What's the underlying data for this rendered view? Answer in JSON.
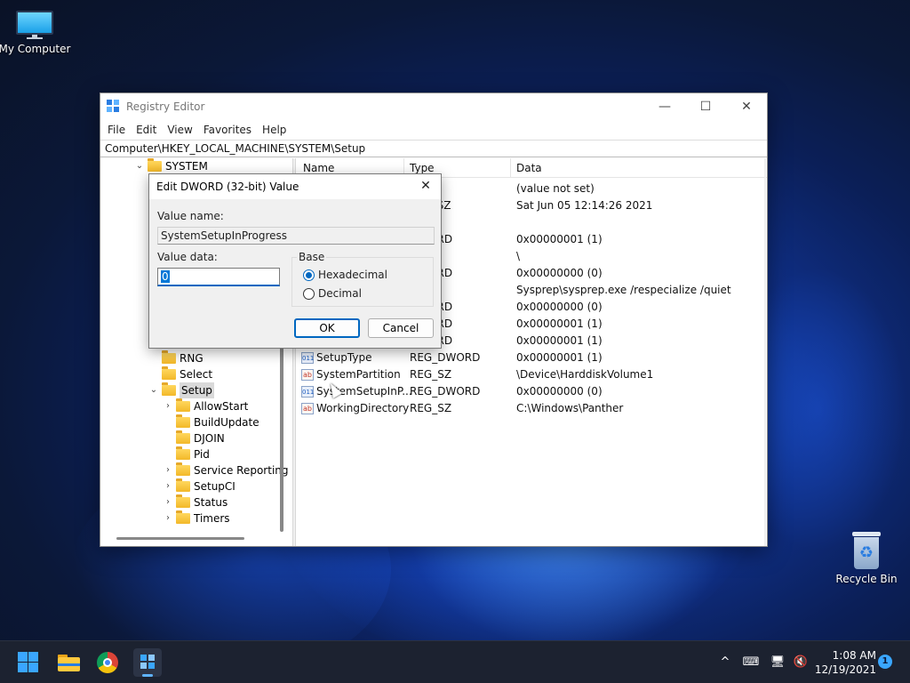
{
  "desktop": {
    "icons": [
      {
        "label": "My Computer",
        "icon": "computer-icon"
      },
      {
        "label": "Recycle Bin",
        "icon": "recycle-bin-icon"
      }
    ]
  },
  "window": {
    "title": "Registry Editor",
    "controls": {
      "minimize": "—",
      "maximize": "☐",
      "close": "✕"
    },
    "menu": [
      "File",
      "Edit",
      "View",
      "Favorites",
      "Help"
    ],
    "address": "Computer\\HKEY_LOCAL_MACHINE\\SYSTEM\\Setup"
  },
  "tree": {
    "root": "SYSTEM",
    "items": [
      {
        "label": "RNG",
        "expandable": false
      },
      {
        "label": "Select",
        "expandable": false
      },
      {
        "label": "Setup",
        "expandable": true,
        "expanded": true,
        "selected": true
      },
      {
        "label": "AllowStart",
        "expandable": true
      },
      {
        "label": "BuildUpdate",
        "expandable": false
      },
      {
        "label": "DJOIN",
        "expandable": false
      },
      {
        "label": "Pid",
        "expandable": false
      },
      {
        "label": "Service Reporting",
        "expandable": true
      },
      {
        "label": "SetupCI",
        "expandable": true
      },
      {
        "label": "Status",
        "expandable": true
      },
      {
        "label": "Timers",
        "expandable": true
      }
    ]
  },
  "list": {
    "columns": [
      "Name",
      "Type",
      "Data"
    ],
    "rows": [
      {
        "name": "",
        "type": "",
        "data": "(value not set)",
        "icon": ""
      },
      {
        "name": "",
        "type": "ULTI_SZ",
        "data": "Sat Jun 05 12:14:26 2021",
        "icon": ""
      },
      {
        "name": "",
        "type": "",
        "data": "",
        "icon": ""
      },
      {
        "name": "",
        "type": "DWORD",
        "data": "0x00000001 (1)",
        "icon": ""
      },
      {
        "name": "",
        "type": "",
        "data": "\\",
        "icon": ""
      },
      {
        "name": "",
        "type": "DWORD",
        "data": "0x00000000 (0)",
        "icon": ""
      },
      {
        "name": "",
        "type": "",
        "data": "Sysprep\\sysprep.exe /respecialize /quiet",
        "icon": ""
      },
      {
        "name": "",
        "type": "DWORD",
        "data": "0x00000000 (0)",
        "icon": ""
      },
      {
        "name": "",
        "type": "DWORD",
        "data": "0x00000001 (1)",
        "icon": ""
      },
      {
        "name": "",
        "type": "DWORD",
        "data": "0x00000001 (1)",
        "icon": ""
      },
      {
        "name": "SetupType",
        "type": "REG_DWORD",
        "data": "0x00000001 (1)",
        "icon": "dword-value-icon"
      },
      {
        "name": "SystemPartition",
        "type": "REG_SZ",
        "data": "\\Device\\HarddiskVolume1",
        "icon": "string-value-icon"
      },
      {
        "name": "SystemSetupInP...",
        "type": "REG_DWORD",
        "data": "0x00000000 (0)",
        "icon": "dword-value-icon"
      },
      {
        "name": "WorkingDirectory",
        "type": "REG_SZ",
        "data": "C:\\Windows\\Panther",
        "icon": "string-value-icon"
      }
    ]
  },
  "dialog": {
    "title": "Edit DWORD (32-bit) Value",
    "value_name_label": "Value name:",
    "value_name": "SystemSetupInProgress",
    "value_data_label": "Value data:",
    "value_data": "0",
    "base_label": "Base",
    "base_options": [
      "Hexadecimal",
      "Decimal"
    ],
    "base_selected": "Hexadecimal",
    "ok_label": "OK",
    "cancel_label": "Cancel",
    "close_glyph": "✕"
  },
  "taskbar": {
    "apps": [
      "start-icon",
      "file-explorer-icon",
      "chrome-icon",
      "registry-editor-icon"
    ],
    "tray": {
      "chevron": "^",
      "keyboard": "⌨",
      "network": "🖥",
      "volume": "🔇"
    },
    "time": "1:08 AM",
    "date": "12/19/2021",
    "notifications": "1"
  }
}
